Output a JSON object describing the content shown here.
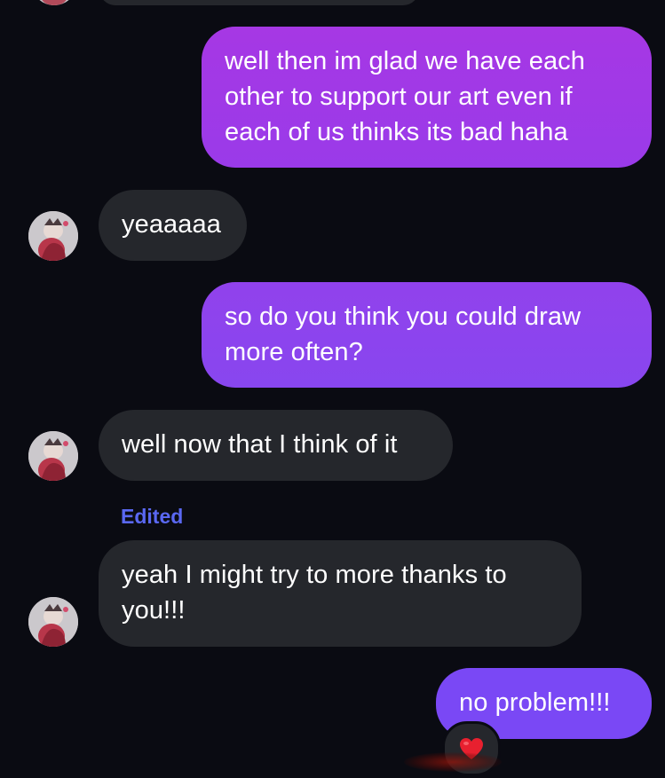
{
  "colors": {
    "background": "#0a0b12",
    "incoming_bubble": "#25272c",
    "outgoing_gradient_top": "#a838e4",
    "outgoing_gradient_bottom": "#7a44f6",
    "edited_label": "#5a68f2"
  },
  "messages": [
    {
      "direction": "outgoing",
      "text": "well then im glad we have each other to support our art even if each of us thinks its bad haha"
    },
    {
      "direction": "incoming",
      "text": "yeaaaaa"
    },
    {
      "direction": "outgoing",
      "text": "so do you think you could draw more often?"
    },
    {
      "direction": "incoming",
      "text": "well now that I think of it"
    },
    {
      "direction": "incoming",
      "text": "yeah I might try to more thanks to you!!!",
      "label": "Edited"
    },
    {
      "direction": "outgoing",
      "text": "no problem!!!",
      "reaction": "❤️"
    }
  ],
  "icons": {
    "avatar": "sender-avatar-icon",
    "reaction": "red-heart-icon"
  }
}
